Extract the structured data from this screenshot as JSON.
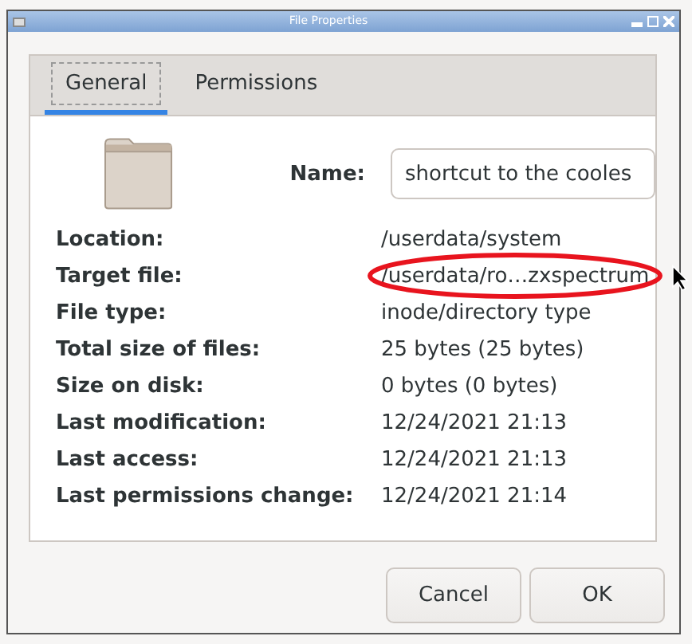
{
  "window": {
    "title": "File Properties"
  },
  "tabs": [
    {
      "label": "General",
      "selected": true
    },
    {
      "label": "Permissions",
      "selected": false
    }
  ],
  "name": {
    "label": "Name:",
    "value": "shortcut to the cooles"
  },
  "properties": [
    {
      "label": "Location:",
      "value": "/userdata/system",
      "circled": false
    },
    {
      "label": "Target file:",
      "value": "/userdata/ro…zxspectrum",
      "circled": true
    },
    {
      "label": "File type:",
      "value": "inode/directory type",
      "circled": false
    },
    {
      "label": "Total size of files:",
      "value": "25 bytes (25 bytes)",
      "circled": false
    },
    {
      "label": "Size on disk:",
      "value": "0 bytes (0 bytes)",
      "circled": false
    },
    {
      "label": "Last modification:",
      "value": "12/24/2021 21:13",
      "circled": false
    },
    {
      "label": "Last access:",
      "value": "12/24/2021 21:13",
      "circled": false
    },
    {
      "label": "Last permissions change:",
      "value": "12/24/2021 21:14",
      "circled": false
    }
  ],
  "buttons": [
    "Cancel",
    "OK"
  ]
}
